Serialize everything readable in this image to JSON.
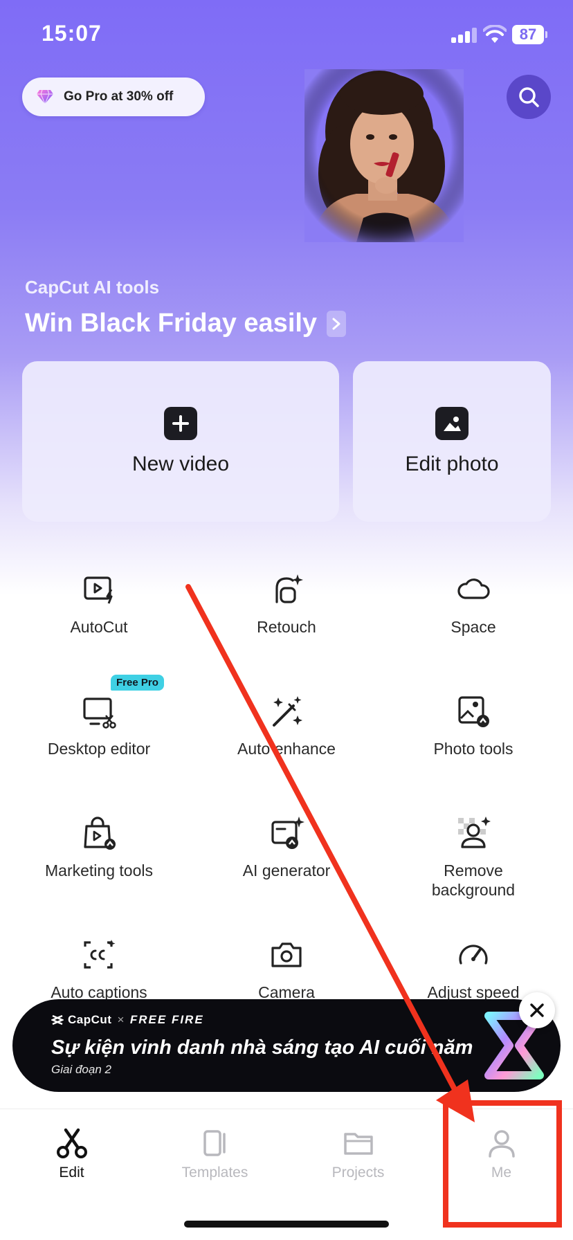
{
  "status": {
    "time": "15:07",
    "battery": "87"
  },
  "promo": {
    "label": "Go Pro at 30% off"
  },
  "hero": {
    "subtitle": "CapCut AI tools",
    "title": "Win Black Friday easily"
  },
  "actions": {
    "new_video": "New video",
    "edit_photo": "Edit photo"
  },
  "tools": [
    {
      "label": "AutoCut",
      "icon": "autocut-icon"
    },
    {
      "label": "Retouch",
      "icon": "retouch-icon"
    },
    {
      "label": "Space",
      "icon": "cloud-icon"
    },
    {
      "label": "Desktop editor",
      "icon": "desktop-editor-icon",
      "badge": "Free Pro"
    },
    {
      "label": "Auto enhance",
      "icon": "magic-wand-icon"
    },
    {
      "label": "Photo tools",
      "icon": "photo-tools-icon"
    },
    {
      "label": "Marketing tools",
      "icon": "marketing-bag-icon"
    },
    {
      "label": "AI generator",
      "icon": "ai-generator-icon"
    },
    {
      "label": "Remove\nbackground",
      "icon": "remove-background-icon"
    },
    {
      "label": "Auto captions",
      "icon": "captions-icon"
    },
    {
      "label": "Camera",
      "icon": "camera-icon"
    },
    {
      "label": "Adjust speed",
      "icon": "speedometer-icon"
    }
  ],
  "banner": {
    "brand": "CapCut",
    "partner": "FREE FIRE",
    "separator": "×",
    "headline": "Sự kiện vinh danh nhà sáng tạo AI cuối năm",
    "sub": "Giai đoạn 2"
  },
  "tabs": [
    {
      "label": "Edit",
      "active": true
    },
    {
      "label": "Templates",
      "active": false
    },
    {
      "label": "Projects",
      "active": false
    },
    {
      "label": "Me",
      "active": false
    }
  ],
  "colors": {
    "accent": "#7f6cf6",
    "annotation": "#f0321e",
    "badge": "#3fd0e4"
  }
}
